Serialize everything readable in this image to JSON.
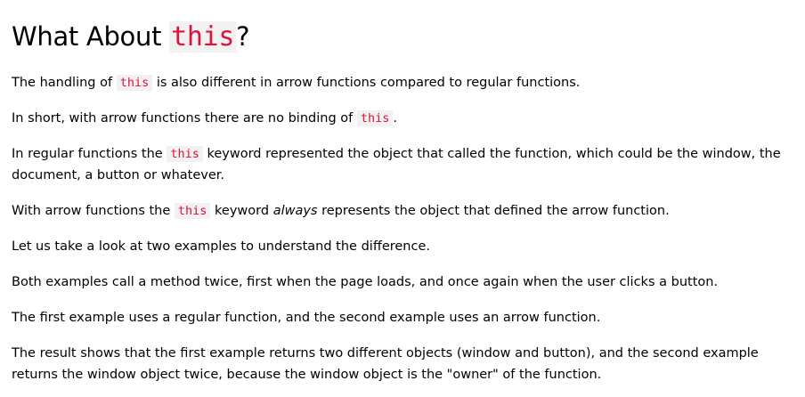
{
  "heading": {
    "prefix": "What About ",
    "code": "this",
    "suffix": "?"
  },
  "p1": {
    "before": "The handling of ",
    "code": "this",
    "after": " is also different in arrow functions compared to regular functions."
  },
  "p2": {
    "before": "In short, with arrow functions there are no binding of ",
    "code": "this",
    "after": "."
  },
  "p3": {
    "before": "In regular functions the ",
    "code": "this",
    "after": " keyword represented the object that called the function, which could be the window, the document, a button or whatever."
  },
  "p4": {
    "before": "With arrow functions the ",
    "code": "this",
    "middle": " keyword ",
    "emphasis": "always",
    "after": " represents the object that defined the arrow function."
  },
  "p5": "Let us take a look at two examples to understand the difference.",
  "p6": "Both examples call a method twice, first when the page loads, and once again when the user clicks a button.",
  "p7": "The first example uses a regular function, and the second example uses an arrow function.",
  "p8": "The result shows that the first example returns two different objects (window and button), and the second example returns the window object twice, because the window object is the \"owner\" of the function."
}
